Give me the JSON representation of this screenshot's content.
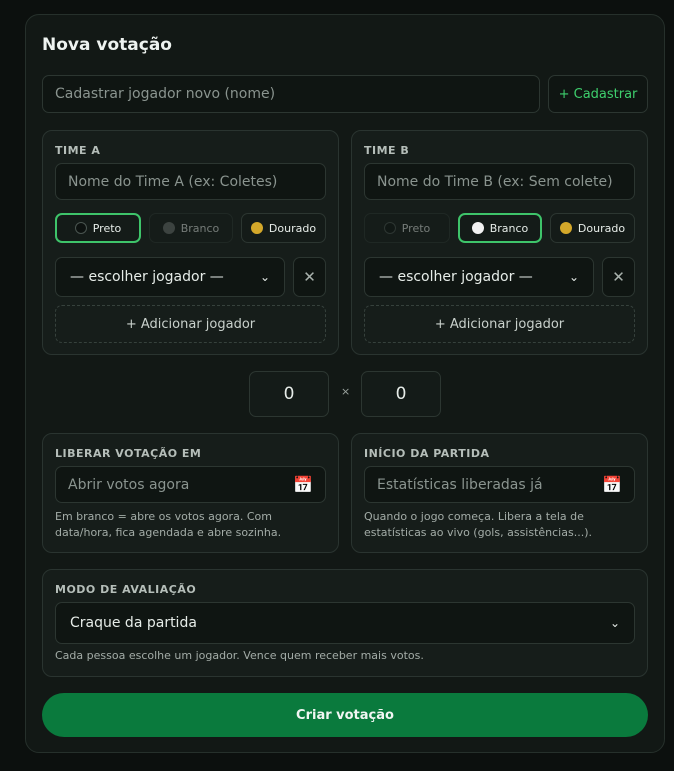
{
  "title": "Nova votação",
  "new_player": {
    "placeholder": "Cadastrar jogador novo (nome)",
    "button": "+ Cadastrar"
  },
  "team_a": {
    "label": "TIME A",
    "name_placeholder": "Nome do Time A (ex: Coletes)",
    "colors": [
      {
        "label": "Preto",
        "state": "selected"
      },
      {
        "label": "Branco",
        "state": "disabled"
      },
      {
        "label": "Dourado",
        "state": "normal"
      }
    ],
    "player_select": "— escolher jogador —",
    "remove": "✕",
    "add_player": "+ Adicionar jogador"
  },
  "team_b": {
    "label": "TIME B",
    "name_placeholder": "Nome do Time B (ex: Sem colete)",
    "colors": [
      {
        "label": "Preto",
        "state": "disabled"
      },
      {
        "label": "Branco",
        "state": "selected"
      },
      {
        "label": "Dourado",
        "state": "normal"
      }
    ],
    "player_select": "— escolher jogador —",
    "remove": "✕",
    "add_player": "+ Adicionar jogador"
  },
  "score": {
    "a": "0",
    "sep": "×",
    "b": "0"
  },
  "liberar": {
    "label": "LIBERAR VOTAÇÃO EM",
    "placeholder": "Abrir votos agora",
    "hint": "Em branco = abre os votos agora. Com data/hora, fica agendada e abre sozinha."
  },
  "inicio": {
    "label": "INÍCIO DA PARTIDA",
    "placeholder": "Estatísticas liberadas já",
    "hint": "Quando o jogo começa. Libera a tela de estatísticas ao vivo (gols, assistências...)."
  },
  "modo": {
    "label": "MODO DE AVALIAÇÃO",
    "selected": "Craque da partida",
    "hint": "Cada pessoa escolhe um jogador. Vence quem receber mais votos."
  },
  "submit": "Criar votação",
  "icons": {
    "calendar": "calendar-icon",
    "chevron": "chevron-down-icon",
    "close": "close-icon"
  },
  "colors": {
    "accent": "#3ec46a",
    "primary_button": "#0a7a3d",
    "gold": "#d4a82a"
  }
}
